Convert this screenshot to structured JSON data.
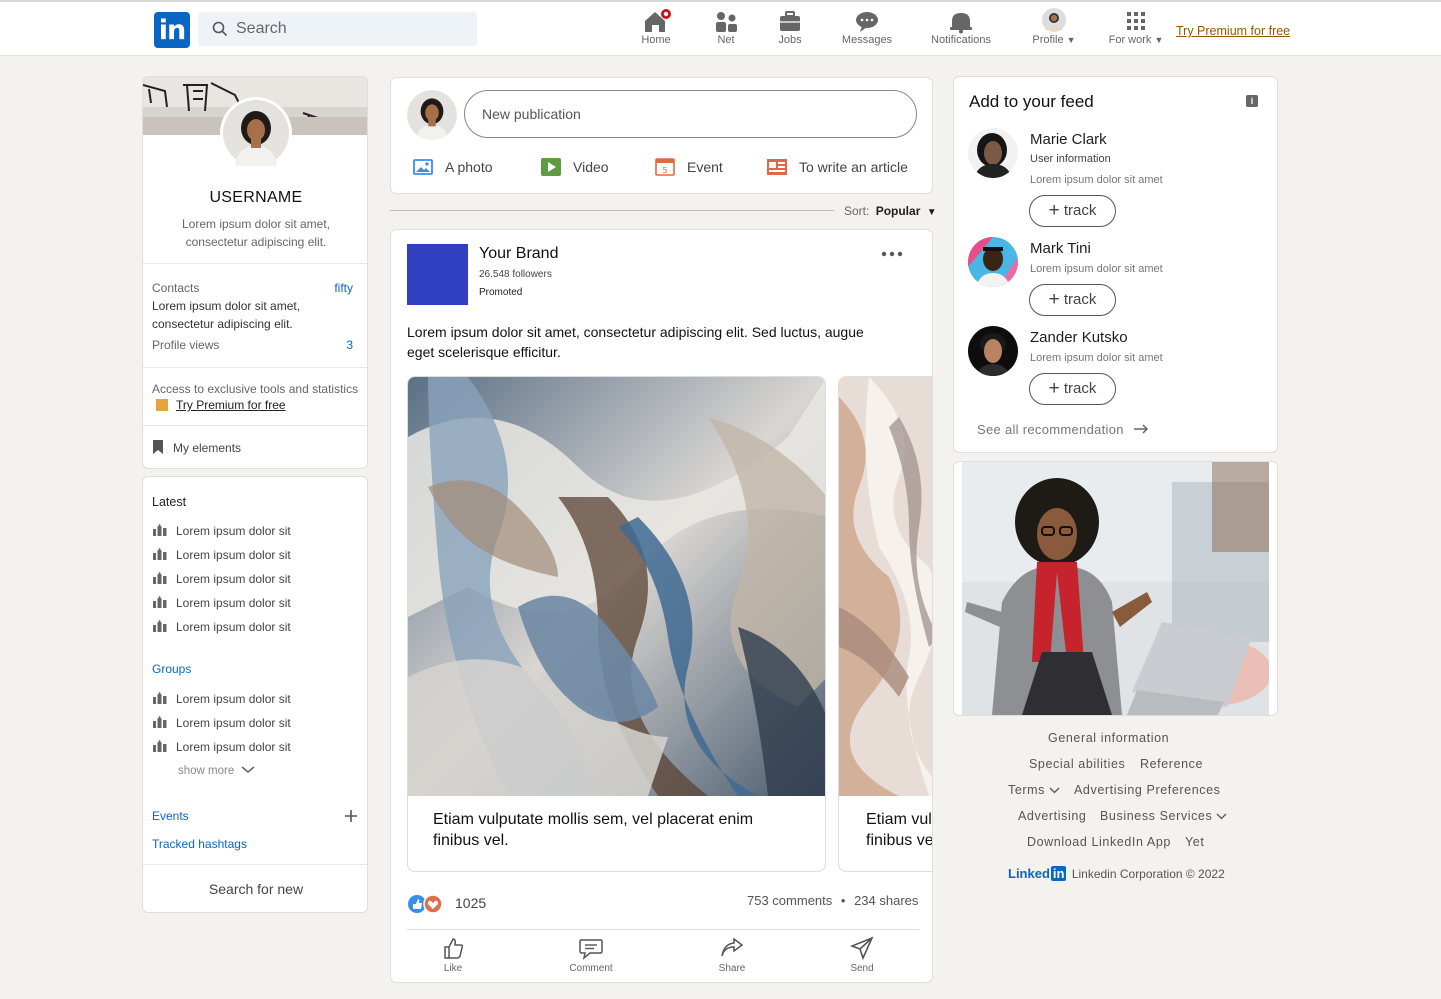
{
  "header": {
    "logo_text": "in",
    "search_placeholder": "Search",
    "nav": [
      {
        "label": "Home",
        "icon": "home-icon"
      },
      {
        "label": "Net",
        "icon": "network-icon"
      },
      {
        "label": "Jobs",
        "icon": "briefcase-icon"
      },
      {
        "label": "Messages",
        "icon": "messages-icon"
      },
      {
        "label": "Notifications",
        "icon": "bell-icon"
      },
      {
        "label": "Profile",
        "icon": "profile-avatar"
      },
      {
        "label": "For work",
        "icon": "grid-icon"
      }
    ],
    "premium_link": "Try Premium for free"
  },
  "profile_card": {
    "username": "USERNAME",
    "bio_line1": "Lorem ipsum dolor sit amet,",
    "bio_line2": "consectetur adipiscing elit.",
    "contacts_label": "Contacts",
    "contacts_value": "fifty",
    "contacts_text1": "Lorem ipsum dolor sit amet,",
    "contacts_text2": "consectetur adipiscing elit.",
    "views_label": "Profile views",
    "views_value": "3",
    "premium_text": "Access to exclusive tools and statistics",
    "premium_link": "Try Premium for free",
    "my_elements": "My elements"
  },
  "sidebar": {
    "latest_title": "Latest",
    "latest_items": [
      "Lorem ipsum dolor sit",
      "Lorem ipsum dolor sit",
      "Lorem ipsum dolor sit",
      "Lorem ipsum dolor sit",
      "Lorem ipsum dolor sit"
    ],
    "groups_title": "Groups",
    "group_items": [
      "Lorem ipsum dolor sit",
      "Lorem ipsum dolor sit",
      "Lorem ipsum dolor sit"
    ],
    "show_more": "show more",
    "events": "Events",
    "hashtags": "Tracked hashtags",
    "search_new": "Search for new"
  },
  "composer": {
    "placeholder": "New publication",
    "photo": "A photo",
    "video": "Video",
    "event": "Event",
    "article": "To write an article"
  },
  "sort": {
    "label": "Sort:",
    "value": "Popular"
  },
  "post": {
    "brand": "Your Brand",
    "followers": "26.548 followers",
    "promoted": "Promoted",
    "text_line1": "Lorem ipsum dolor sit amet, consectetur adipiscing elit. Sed luctus, augue",
    "text_line2": "eget scelerisque efficitur.",
    "carousel": [
      {
        "line1": "Etiam vulputate mollis sem, vel placerat enim",
        "line2": "finibus vel."
      },
      {
        "line1": "Etiam vulputate mollis sem, vel placerat enim",
        "line2": "finibus vel."
      }
    ],
    "reactions": "1025",
    "comments": "753 comments",
    "dot": "•",
    "shares": "234 shares",
    "actions": {
      "like": "Like",
      "comment": "Comment",
      "share": "Share",
      "send": "Send"
    }
  },
  "feed": {
    "title": "Add to your feed",
    "info_badge": "i",
    "people": [
      {
        "name": "Marie Clark",
        "sub": "User information",
        "desc": "Lorem ipsum dolor sit amet"
      },
      {
        "name": "Mark Tini",
        "desc": "Lorem ipsum dolor sit amet"
      },
      {
        "name": "Zander Kutsko",
        "desc": "Lorem ipsum dolor sit amet"
      }
    ],
    "track_label": "track",
    "see_all": "See all recommendation"
  },
  "footer": {
    "general": "General information",
    "special": "Special abilities",
    "reference": "Reference",
    "terms": "Terms",
    "ad_prefs": "Advertising Preferences",
    "advertising": "Advertising",
    "business": "Business Services",
    "download": "Download LinkedIn App",
    "yet": "Yet",
    "brand_word": "Linked",
    "brand_in": "in",
    "copyright": "Linkedin Corporation © 2022"
  },
  "colors": {
    "accent": "#0a66c2",
    "brand_square": "#2f3fbf",
    "premium": "#915907",
    "notif_badge": "#cc1016"
  }
}
